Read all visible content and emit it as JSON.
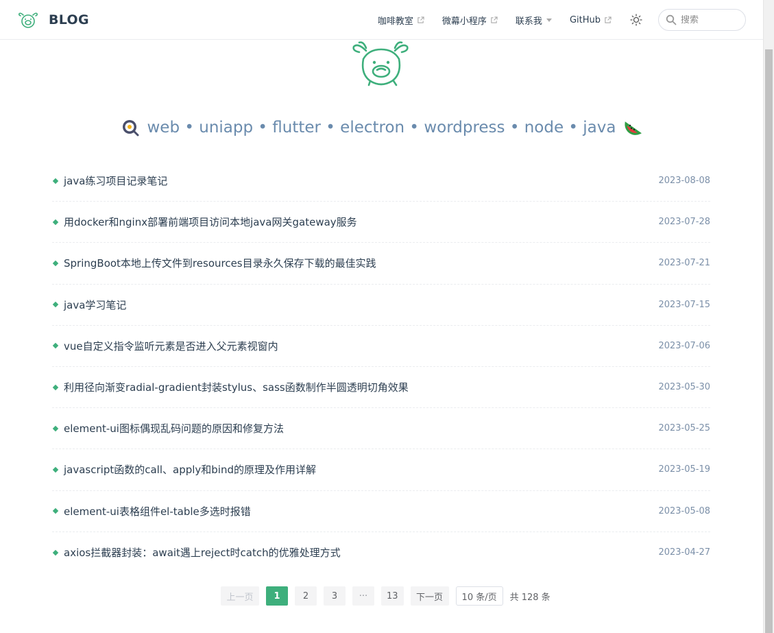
{
  "header": {
    "brand_title": "BLOG",
    "nav": [
      {
        "label": "咖啡教室",
        "external": true
      },
      {
        "label": "微幕小程序",
        "external": true
      },
      {
        "label": "联系我",
        "dropdown": true
      },
      {
        "label": "GitHub",
        "external": true
      }
    ],
    "search_placeholder": "搜索"
  },
  "hero": {
    "tagline": "web • uniapp • flutter • electron • wordpress • node • java"
  },
  "posts": [
    {
      "title": "java练习项目记录笔记",
      "date": "2023-08-08"
    },
    {
      "title": "用docker和nginx部署前端项目访问本地java网关gateway服务",
      "date": "2023-07-28"
    },
    {
      "title": "SpringBoot本地上传文件到resources目录永久保存下载的最佳实践",
      "date": "2023-07-21"
    },
    {
      "title": "java学习笔记",
      "date": "2023-07-15"
    },
    {
      "title": "vue自定义指令监听元素是否进入父元素视窗内",
      "date": "2023-07-06"
    },
    {
      "title": "利用径向渐变radial-gradient封装stylus、sass函数制作半圆透明切角效果",
      "date": "2023-05-30"
    },
    {
      "title": "element-ui图标偶现乱码问题的原因和修复方法",
      "date": "2023-05-25"
    },
    {
      "title": "javascript函数的call、apply和bind的原理及作用详解",
      "date": "2023-05-19"
    },
    {
      "title": "element-ui表格组件el-table多选时报错",
      "date": "2023-05-08"
    },
    {
      "title": "axios拦截器封装：await遇上reject时catch的优雅处理方式",
      "date": "2023-04-27"
    }
  ],
  "pagination": {
    "prev": "上一页",
    "pages": [
      "1",
      "2",
      "3",
      "···",
      "13"
    ],
    "active_page": "1",
    "next": "下一页",
    "page_size": "10 条/页",
    "total": "共 128 条"
  },
  "colors": {
    "accent": "#3eaf7c",
    "tagline": "#6a8bad",
    "text": "#2c3e50"
  }
}
